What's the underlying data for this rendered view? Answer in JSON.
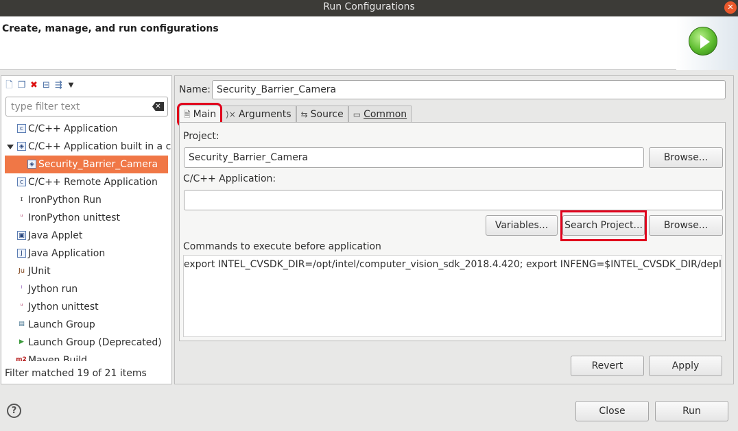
{
  "window": {
    "title": "Run Configurations",
    "close_glyph": "✕"
  },
  "header": {
    "title": "Create, manage, and run configurations",
    "badge_icon": "run-icon"
  },
  "left": {
    "toolbar_icons": [
      "new-config-icon",
      "duplicate-icon",
      "delete-icon",
      "collapse-all-icon",
      "filter-icon",
      "view-menu-icon"
    ],
    "filter_placeholder": "type filter text",
    "tree": [
      {
        "label": "C/C++ Application",
        "icon": "c"
      },
      {
        "label": "C/C++ Application built in a container",
        "icon": "◈",
        "expanded": true
      },
      {
        "label": "Security_Barrier_Camera",
        "icon": "◈",
        "selected": true
      },
      {
        "label": "C/C++ Remote Application",
        "icon": "c"
      },
      {
        "label": "IronPython Run",
        "icon": "ɪ"
      },
      {
        "label": "IronPython unittest",
        "icon": "ᵘ"
      },
      {
        "label": "Java Applet",
        "icon": "▣"
      },
      {
        "label": "Java Application",
        "icon": "J"
      },
      {
        "label": "JUnit",
        "icon": "Ju"
      },
      {
        "label": "Jython run",
        "icon": "ʲ"
      },
      {
        "label": "Jython unittest",
        "icon": "ᵘ"
      },
      {
        "label": "Launch Group",
        "icon": "▤"
      },
      {
        "label": "Launch Group (Deprecated)",
        "icon": "▶"
      },
      {
        "label": "Maven Build",
        "icon": "m2"
      }
    ],
    "status": "Filter matched 19 of 21 items"
  },
  "right": {
    "name_label": "Name:",
    "name_value": "Security_Barrier_Camera",
    "tabs": [
      {
        "label": "Main",
        "icon": "🗎",
        "active": true
      },
      {
        "label": "Arguments",
        "icon": "⟩×"
      },
      {
        "label": "Source",
        "icon": "⇆"
      },
      {
        "label": "Common",
        "icon": "▭"
      }
    ],
    "project_label": "Project:",
    "project_value": "Security_Barrier_Camera",
    "browse_label": "Browse...",
    "app_label": "C/C++ Application:",
    "app_value": "",
    "variables_label": "Variables...",
    "search_project_label": "Search Project...",
    "commands_label": "Commands to execute before application",
    "commands_value": "export INTEL_CVSDK_DIR=/opt/intel/computer_vision_sdk_2018.4.420; export INFENG=$INTEL_CVSDK_DIR/deployment_tools/inference_engine",
    "revert_label": "Revert",
    "apply_label": "Apply"
  },
  "footer": {
    "help_glyph": "?",
    "close_label": "Close",
    "run_label": "Run"
  }
}
